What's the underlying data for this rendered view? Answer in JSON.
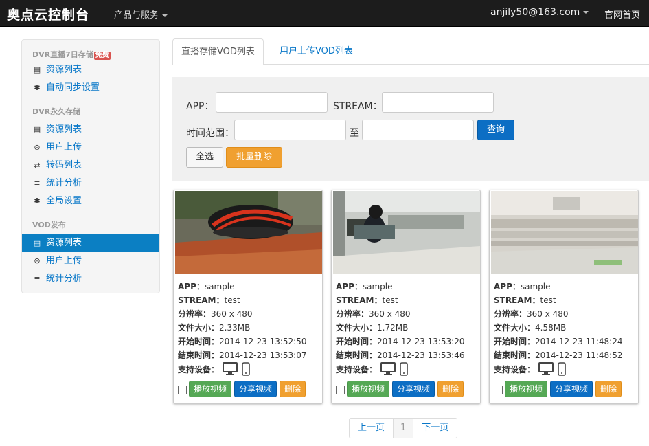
{
  "topbar": {
    "brand": "奥点云控制台",
    "products_menu": "产品与服务",
    "user_email": "anjily50@163.com",
    "home_link": "官网首页"
  },
  "sidebar": {
    "section1_title": "DVR直播7日存储",
    "section1_badge": "免费",
    "section1_items": [
      {
        "label": "资源列表",
        "icon": "film-icon"
      },
      {
        "label": "自动同步设置",
        "icon": "gear-icon"
      }
    ],
    "section2_title": "DVR永久存储",
    "section2_items": [
      {
        "label": "资源列表",
        "icon": "film-icon"
      },
      {
        "label": "用户上传",
        "icon": "upload-icon"
      },
      {
        "label": "转码列表",
        "icon": "retweet-icon"
      },
      {
        "label": "统计分析",
        "icon": "list-icon"
      },
      {
        "label": "全局设置",
        "icon": "gear-icon"
      }
    ],
    "section3_title": "VOD发布",
    "section3_items": [
      {
        "label": "资源列表",
        "icon": "film-icon",
        "active": true
      },
      {
        "label": "用户上传",
        "icon": "upload-icon"
      },
      {
        "label": "统计分析",
        "icon": "list-icon"
      }
    ]
  },
  "tabs": [
    "直播存储VOD列表",
    "用户上传VOD列表"
  ],
  "filter": {
    "app_label": "APP：",
    "stream_label": "STREAM：",
    "time_label": "时间范围：",
    "to_label": "至",
    "app_value": "",
    "stream_value": "",
    "time_from": "",
    "time_to": "",
    "query_button": "查询",
    "select_all_button": "全选",
    "batch_delete_button": "批量删除"
  },
  "card_labels": {
    "app": "APP：",
    "stream": "STREAM：",
    "resolution": "分辨率：",
    "size": "文件大小：",
    "start": "开始时间：",
    "end": "结束时间：",
    "devices": "支持设备：",
    "play": "播放视频",
    "share": "分享视频",
    "delete": "删除"
  },
  "cards": [
    {
      "app": "sample",
      "stream": "test",
      "resolution": "360 x 480",
      "size": "2.33MB",
      "start": "2014-12-23 13:52:50",
      "end": "2014-12-23 13:53:07",
      "thumbnail": "helmet-photo"
    },
    {
      "app": "sample",
      "stream": "test",
      "resolution": "360 x 480",
      "size": "1.72MB",
      "start": "2014-12-23 13:53:20",
      "end": "2014-12-23 13:53:46",
      "thumbnail": "office-person-photo"
    },
    {
      "app": "sample",
      "stream": "test",
      "resolution": "360 x 480",
      "size": "4.58MB",
      "start": "2014-12-23 11:48:24",
      "end": "2014-12-23 11:48:52",
      "thumbnail": "office-desks-photo"
    }
  ],
  "pagination": {
    "prev": "上一页",
    "current": "1",
    "next": "下一页"
  },
  "colors": {
    "primary": "#0c6ec4",
    "success": "#55a855",
    "warning": "#f0a030",
    "topbar": "#1c1c1c",
    "link": "#0877c8"
  }
}
